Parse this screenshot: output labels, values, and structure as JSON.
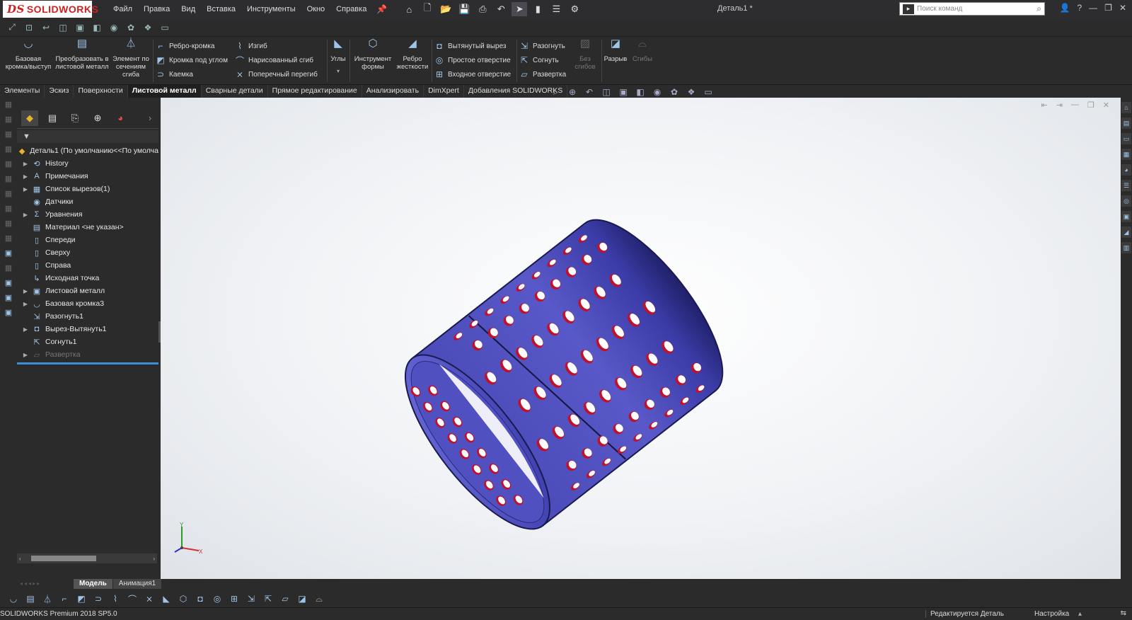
{
  "titlebar": {
    "logo_ds": "DS",
    "logo_text": "SOLIDWORKS",
    "menu": [
      "Файл",
      "Правка",
      "Вид",
      "Вставка",
      "Инструменты",
      "Окно",
      "Справка"
    ],
    "doc_title": "Деталь1 *",
    "search_placeholder": "Поиск команд"
  },
  "commands": {
    "base_flange": "Базовая кромка/выступ",
    "convert": "Преобразовать в листовой металл",
    "lofted_bend": "Элемент по сечениям сгиба",
    "edge_flange": "Ребро-кромка",
    "miter_flange": "Кромка под углом",
    "hem": "Каемка",
    "jog": "Изгиб",
    "sketched_bend": "Нарисованный сгиб",
    "cross_break": "Поперечный перегиб",
    "corners": "Углы",
    "forming_tool": "Инструмент формы",
    "gusset": "Ребро жесткости",
    "extruded_cut": "Вытянутый вырез",
    "simple_hole": "Простое отверстие",
    "vent": "Входное отверстие",
    "unfold": "Разогнуть",
    "fold": "Согнуть",
    "flatten": "Развертка",
    "no_bends": "Без сгибов",
    "rip": "Разрыв",
    "bends": "Сгибы"
  },
  "tabs": [
    "Элементы",
    "Эскиз",
    "Поверхности",
    "Листовой металл",
    "Сварные детали",
    "Прямое редактирование",
    "Анализировать",
    "DimXpert",
    "Добавления SOLIDWORKS"
  ],
  "active_tab": "Листовой металл",
  "tree": {
    "root": "Деталь1  (По умолчанию<<По умолча",
    "nodes": [
      {
        "label": "History",
        "expandable": true,
        "icon": "history-icon"
      },
      {
        "label": "Примечания",
        "expandable": true,
        "icon": "annotations-icon"
      },
      {
        "label": "Список вырезов(1)",
        "expandable": true,
        "icon": "cut-list-icon"
      },
      {
        "label": "Датчики",
        "expandable": false,
        "icon": "sensors-icon"
      },
      {
        "label": "Уравнения",
        "expandable": true,
        "icon": "equations-icon"
      },
      {
        "label": "Материал <не указан>",
        "expandable": false,
        "icon": "material-icon"
      },
      {
        "label": "Спереди",
        "expandable": false,
        "icon": "plane-icon"
      },
      {
        "label": "Сверху",
        "expandable": false,
        "icon": "plane-icon"
      },
      {
        "label": "Справа",
        "expandable": false,
        "icon": "plane-icon"
      },
      {
        "label": "Исходная точка",
        "expandable": false,
        "icon": "origin-icon"
      },
      {
        "label": "Листовой металл",
        "expandable": true,
        "icon": "sheet-metal-icon"
      },
      {
        "label": "Базовая кромка3",
        "expandable": true,
        "icon": "base-flange-icon"
      },
      {
        "label": "Разогнуть1",
        "expandable": false,
        "icon": "unfold-icon"
      },
      {
        "label": "Вырез-Вытянуть1",
        "expandable": true,
        "icon": "extruded-cut-icon"
      },
      {
        "label": "Согнуть1",
        "expandable": false,
        "icon": "fold-icon"
      },
      {
        "label": "Развертка",
        "expandable": true,
        "icon": "flatten-icon",
        "suppressed": true
      }
    ]
  },
  "model_tabs": [
    "Модель",
    "Анимация1"
  ],
  "active_model_tab": "Модель",
  "status": {
    "version": "SOLIDWORKS Premium 2018 SP5.0",
    "editing": "Редактируется Деталь",
    "units": "Настройка"
  },
  "colors": {
    "part_body": "#5050c0",
    "hole_interior": "#c0102a",
    "accent": "#3b8fd9"
  }
}
